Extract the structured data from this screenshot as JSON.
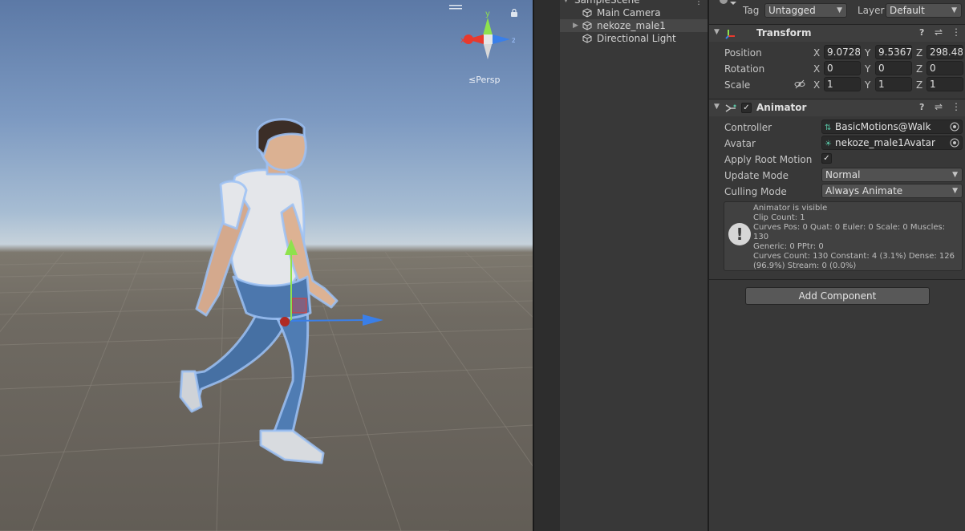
{
  "scene_view": {
    "projection_label": "Persp",
    "gizmo_axes": {
      "x": "x",
      "y": "y",
      "z": "z"
    }
  },
  "hierarchy": {
    "scene_name": "SampleScene",
    "items": [
      {
        "label": "Main Camera",
        "selected": false,
        "has_children": false
      },
      {
        "label": "nekoze_male1",
        "selected": true,
        "has_children": true
      },
      {
        "label": "Directional Light",
        "selected": false,
        "has_children": false
      }
    ]
  },
  "inspector": {
    "tag_label": "Tag",
    "tag_value": "Untagged",
    "layer_label": "Layer",
    "layer_value": "Default",
    "transform": {
      "title": "Transform",
      "position_label": "Position",
      "rotation_label": "Rotation",
      "scale_label": "Scale",
      "axis_x": "X",
      "axis_y": "Y",
      "axis_z": "Z",
      "position": {
        "x": "9.0728",
        "y": "9.5367",
        "z": "298.48"
      },
      "rotation": {
        "x": "0",
        "y": "0",
        "z": "0"
      },
      "scale": {
        "x": "1",
        "y": "1",
        "z": "1"
      }
    },
    "animator": {
      "title": "Animator",
      "enabled": true,
      "controller_label": "Controller",
      "controller_value": "BasicMotions@Walk",
      "avatar_label": "Avatar",
      "avatar_value": "nekoze_male1Avatar",
      "apply_root_motion_label": "Apply Root Motion",
      "apply_root_motion": true,
      "update_mode_label": "Update Mode",
      "update_mode_value": "Normal",
      "culling_mode_label": "Culling Mode",
      "culling_mode_value": "Always Animate",
      "info_lines": [
        "Animator is visible",
        "Clip Count: 1",
        "Curves Pos: 0 Quat: 0 Euler: 0 Scale: 0 Muscles: 130",
        "Generic: 0 PPtr: 0",
        "Curves Count: 130 Constant: 4 (3.1%) Dense: 126",
        "(96.9%) Stream: 0 (0.0%)"
      ]
    },
    "add_component_label": "Add Component"
  },
  "colors": {
    "x_axis": "#e8392d",
    "y_axis": "#8ee24d",
    "z_axis": "#3a7fe8",
    "selection_outline": "#8fb7f0"
  }
}
